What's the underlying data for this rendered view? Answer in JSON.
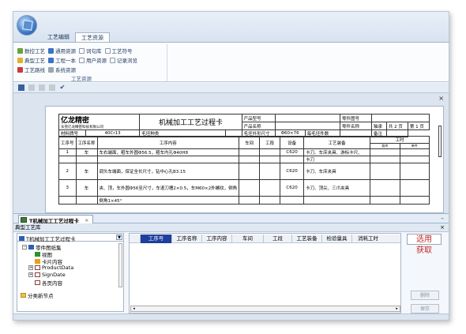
{
  "ribbon": {
    "tabs": [
      {
        "label": "工艺编辑",
        "active": false
      },
      {
        "label": "工艺资源",
        "active": true
      }
    ],
    "rows": [
      [
        {
          "label": "数控工艺",
          "icon": "pencil-icon"
        },
        {
          "label": "通用资源",
          "icon": "globe-icon"
        },
        {
          "label": "词句库",
          "icon": "checkbox-icon"
        },
        {
          "label": "工艺符号",
          "icon": "checkbox-icon"
        }
      ],
      [
        {
          "label": "典型工艺",
          "icon": "flower-icon"
        },
        {
          "label": "工程一本",
          "icon": "book-icon"
        },
        {
          "label": "用户资源",
          "icon": "checkbox-icon"
        },
        {
          "label": "记录浏览",
          "icon": "checkbox-icon"
        }
      ],
      [
        {
          "label": "工艺路线",
          "icon": "route-icon"
        },
        {
          "label": "系统资源",
          "icon": "gear-icon"
        }
      ]
    ],
    "group_label": "工艺资源"
  },
  "document": {
    "header": {
      "company_logo": "亿龙精密",
      "company_sub": "东莞亿龙精密科技有限公司",
      "title": "机械加工工艺过程卡",
      "product_code_label": "产品型号",
      "product_name_label": "产品名称",
      "part_code_label": "零件图号",
      "part_name_label": "零件名称",
      "part_name_value": "轴承",
      "total_pages": "共 2 页",
      "page_label": "第 1 页",
      "material_label": "材料牌号",
      "material_value": "40Cr13",
      "blank_type_label": "毛坯种类",
      "blank_type_value": "",
      "blank_size_label": "毛坯外形尺寸",
      "blank_size_value": "Φ60×76",
      "per_blank_label": "每毛坯件数",
      "per_blank_value": "",
      "note_label": "备注"
    },
    "columns": [
      "工序号",
      "工序名称",
      "工序内容",
      "车间",
      "工段",
      "设备",
      "工艺装备",
      "工时"
    ],
    "time_subcols": [
      "准终",
      "单件"
    ],
    "rows": [
      {
        "no": "1",
        "name": "车",
        "content": "车右端面，粗车外圆Φ56.5，粗车内孔Φ40H8",
        "equip": "C620",
        "tooling": "卡刀、车床夹具、游标卡尺、"
      },
      {
        "no": "",
        "name": "",
        "content": "",
        "equip": "",
        "tooling": "卡刀"
      },
      {
        "no": "2",
        "name": "车",
        "content": "调头车端面，保证全长尺寸，钻中心孔B3.15",
        "equip": "C620",
        "tooling": "卡刀、车床夹具"
      },
      {
        "no": "3",
        "name": "车",
        "content": "夹、顶，车外圆Φ56至尺寸，车退刀槽2×0.5，车M60×2外螺纹，倒角",
        "equip": "C620",
        "tooling": "卡刀、顶尖、三爪夹具"
      },
      {
        "no": "",
        "name": "",
        "content": "倒角1×45°",
        "equip": "",
        "tooling": ""
      }
    ]
  },
  "doc_tab": {
    "label": "T机械加工工艺过程卡"
  },
  "library": {
    "title": "典型工艺库",
    "combo_value": "T机械加工工艺过程卡",
    "tree": [
      {
        "label": "零件图纸集",
        "icon": "folder-blue",
        "level": 1,
        "expander": "−"
      },
      {
        "label": "视图",
        "icon": "diamond-green",
        "level": 2
      },
      {
        "label": "卡片内容",
        "icon": "diamond-orange",
        "level": 2
      },
      {
        "label": "ProductData",
        "icon": "doc",
        "level": 2,
        "expander": "+"
      },
      {
        "label": "SignDate",
        "icon": "doc",
        "level": 2,
        "expander": "+"
      },
      {
        "label": "各页内容",
        "icon": "doc",
        "level": 2
      }
    ],
    "new_node_label": "分类新节点"
  },
  "grid": {
    "headers": [
      "工序号",
      "工序名称",
      "工序内容",
      "车间",
      "工段",
      "工艺装备",
      "检验量具",
      "消耗工时"
    ],
    "selected": 0
  },
  "side": {
    "apply_label": "选用",
    "fetch_label": "获取",
    "delete_label": "删除",
    "save_label": "保存"
  }
}
